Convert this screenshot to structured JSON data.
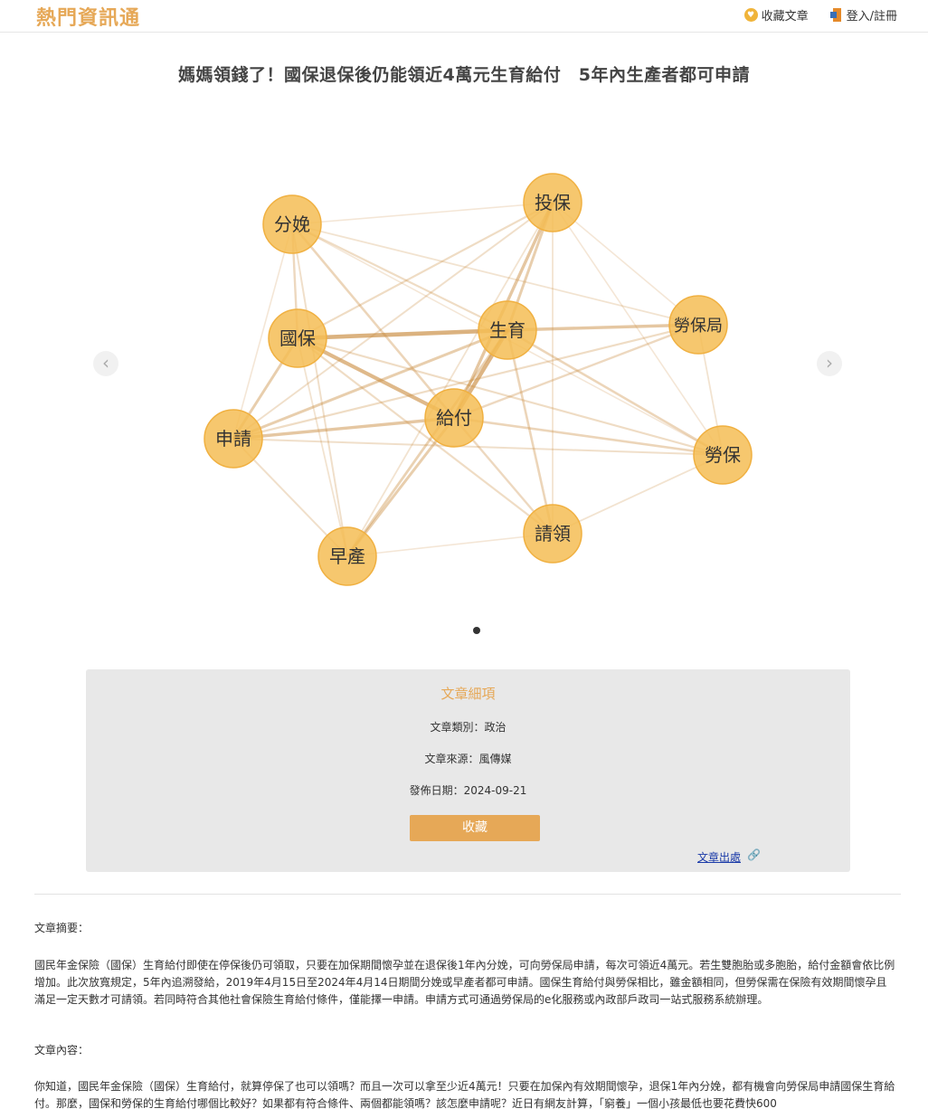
{
  "header": {
    "brand": "熱門資訊通",
    "favorites_label": "收藏文章",
    "login_label": "登入/註冊"
  },
  "article": {
    "title": "媽媽領錢了！國保退保後仍能領近4萬元生育給付　5年內生產者都可申請"
  },
  "carousel": {
    "prev_icon": "chevron-left-icon",
    "next_icon": "chevron-right-icon"
  },
  "graph": {
    "nodes": [
      "投保",
      "分娩",
      "勞保局",
      "國保",
      "生育",
      "給付",
      "申請",
      "勞保",
      "請領",
      "早產"
    ],
    "node_color": "#f5bd55",
    "edge_color": "#c98a3c",
    "edges": [
      {
        "a": "國保",
        "b": "生育",
        "w": 0.9
      },
      {
        "a": "國保",
        "b": "給付",
        "w": 0.8
      },
      {
        "a": "生育",
        "b": "給付",
        "w": 0.85
      },
      {
        "a": "生育",
        "b": "勞保局",
        "w": 0.6
      },
      {
        "a": "申請",
        "b": "給付",
        "w": 0.6
      },
      {
        "a": "申請",
        "b": "生育",
        "w": 0.5
      },
      {
        "a": "申請",
        "b": "國保",
        "w": 0.5
      },
      {
        "a": "投保",
        "b": "給付",
        "w": 0.6
      },
      {
        "a": "投保",
        "b": "生育",
        "w": 0.5
      },
      {
        "a": "早產",
        "b": "給付",
        "w": 0.5
      },
      {
        "a": "早產",
        "b": "生育",
        "w": 0.45
      },
      {
        "a": "分娩",
        "b": "給付",
        "w": 0.4
      },
      {
        "a": "分娩",
        "b": "國保",
        "w": 0.35
      },
      {
        "a": "分娩",
        "b": "生育",
        "w": 0.3
      },
      {
        "a": "勞保",
        "b": "給付",
        "w": 0.4
      },
      {
        "a": "勞保",
        "b": "生育",
        "w": 0.4
      },
      {
        "a": "勞保",
        "b": "國保",
        "w": 0.3
      },
      {
        "a": "請領",
        "b": "生育",
        "w": 0.4
      },
      {
        "a": "請領",
        "b": "給付",
        "w": 0.35
      },
      {
        "a": "請領",
        "b": "國保",
        "w": 0.3
      },
      {
        "a": "勞保局",
        "b": "給付",
        "w": 0.35
      },
      {
        "a": "勞保局",
        "b": "申請",
        "w": 0.3
      },
      {
        "a": "勞保局",
        "b": "勞保",
        "w": 0.2
      },
      {
        "a": "投保",
        "b": "國保",
        "w": 0.3
      },
      {
        "a": "投保",
        "b": "申請",
        "w": 0.25
      },
      {
        "a": "分娩",
        "b": "早產",
        "w": 0.25
      },
      {
        "a": "分娩",
        "b": "勞保局",
        "w": 0.2
      },
      {
        "a": "分娩",
        "b": "投保",
        "w": 0.15
      },
      {
        "a": "申請",
        "b": "早產",
        "w": 0.25
      },
      {
        "a": "申請",
        "b": "勞保",
        "w": 0.25
      },
      {
        "a": "請領",
        "b": "勞保",
        "w": 0.2
      },
      {
        "a": "請領",
        "b": "投保",
        "w": 0.2
      },
      {
        "a": "早產",
        "b": "國保",
        "w": 0.2
      },
      {
        "a": "早產",
        "b": "投保",
        "w": 0.2
      },
      {
        "a": "早產",
        "b": "請領",
        "w": 0.15
      },
      {
        "a": "投保",
        "b": "勞保局",
        "w": 0.15
      },
      {
        "a": "投保",
        "b": "勞保",
        "w": 0.15
      },
      {
        "a": "分娩",
        "b": "勞保",
        "w": 0.15
      },
      {
        "a": "分娩",
        "b": "申請",
        "w": 0.15
      }
    ]
  },
  "details": {
    "heading": "文章細項",
    "category_label": "文章類別：",
    "category": "政治",
    "source_label": "文章來源：",
    "source": "風傳媒",
    "date_label": "發佈日期：",
    "date": "2024-09-21",
    "save_label": "收藏",
    "origin_link": "文章出處"
  },
  "summary": {
    "label": "文章摘要：",
    "text": "國民年金保險（國保）生育給付即使在停保後仍可領取，只要在加保期間懷孕並在退保後1年內分娩，可向勞保局申請，每次可領近4萬元。若生雙胞胎或多胞胎，給付金額會依比例增加。此次放寬規定，5年內追溯發給，2019年4月15日至2024年4月14日期間分娩或早產者都可申請。國保生育給付與勞保相比，雖金額相同，但勞保需在保險有效期間懷孕且滿足一定天數才可請領。若同時符合其他社會保險生育給付條件，僅能擇一申請。申請方式可通過勞保局的e化服務或內政部戶政司一站式服務系統辦理。"
  },
  "content": {
    "label": "文章內容：",
    "text": "你知道，國民年金保險（國保）生育給付，就算停保了也可以領嗎？而且一次可以拿至少近4萬元！只要在加保內有效期間懷孕，退保1年內分娩，都有機會向勞保局申請國保生育給付。那麼，國保和勞保的生育給付哪個比較好？如果都有符合條件、兩個都能領嗎？該怎麼申請呢？近日有網友計算，「窮養」一個小孩最低也要花費快600"
  }
}
